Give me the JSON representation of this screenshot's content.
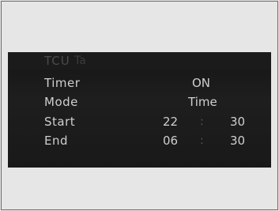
{
  "header": {
    "title": "TCU",
    "subtitle": "Ta"
  },
  "rows": [
    {
      "label": "Timer",
      "value": "ON"
    },
    {
      "label": "Mode",
      "value": "Time"
    },
    {
      "label": "Start",
      "hour": "22",
      "sep": ":",
      "minute": "30"
    },
    {
      "label": "End",
      "hour": "06",
      "sep": ":",
      "minute": "30"
    }
  ]
}
